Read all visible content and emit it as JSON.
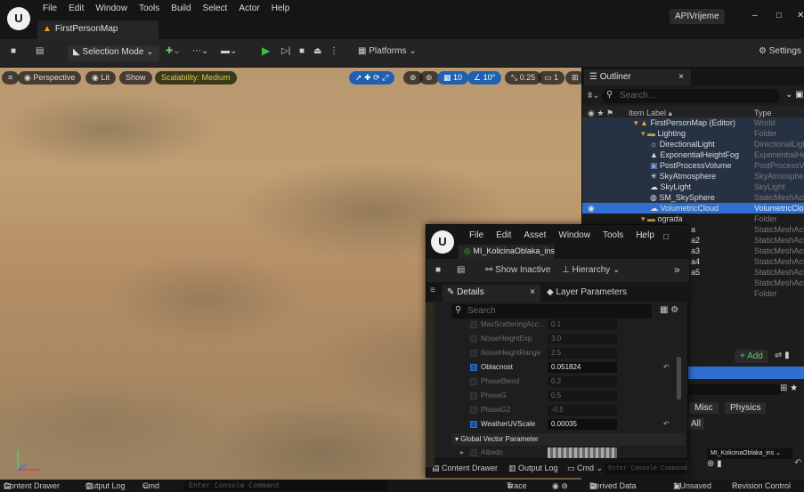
{
  "app": {
    "logo": "U",
    "menu": [
      "File",
      "Edit",
      "Window",
      "Tools",
      "Build",
      "Select",
      "Actor",
      "Help"
    ],
    "map_tab": "FirstPersonMap",
    "project": "APIVrijeme",
    "window_controls": [
      "–",
      "□",
      "✕"
    ]
  },
  "toolbar": {
    "selection_mode": "Selection Mode",
    "platforms": "Platforms",
    "settings": "Settings"
  },
  "viewport": {
    "perspective": "Perspective",
    "lit": "Lit",
    "show": "Show",
    "scalability": "Scalability: Medium",
    "grid_value": "10",
    "angle_value": "10°",
    "scale_value": "0.25",
    "camera_speed": "1"
  },
  "outliner": {
    "tab": "Outliner",
    "search_placeholder": "Search...",
    "col_label": "Item Label",
    "col_type": "Type",
    "rows": [
      {
        "label": "FirstPersonMap (Editor)",
        "type": "World"
      },
      {
        "label": "Lighting",
        "type": "Folder"
      },
      {
        "label": "DirectionalLight",
        "type": "DirectionalLight"
      },
      {
        "label": "ExponentialHeightFog",
        "type": "ExponentialHeightFog"
      },
      {
        "label": "PostProcessVolume",
        "type": "PostProcessVolume"
      },
      {
        "label": "SkyAtmosphere",
        "type": "SkyAtmosphere"
      },
      {
        "label": "SkyLight",
        "type": "SkyLight"
      },
      {
        "label": "SM_SkySphere",
        "type": "StaticMeshActor"
      },
      {
        "label": "VolumetricCloud",
        "type": "VolumetricCloud"
      },
      {
        "label": "ograda",
        "type": "Folder"
      },
      {
        "label": "a",
        "type": "StaticMeshActor"
      },
      {
        "label": "a2",
        "type": "StaticMeshActor"
      },
      {
        "label": "a3",
        "type": "StaticMeshActor"
      },
      {
        "label": "a4",
        "type": "StaticMeshActor"
      },
      {
        "label": "a5",
        "type": "StaticMeshActor"
      },
      {
        "label": "",
        "type": "StaticMeshActor"
      },
      {
        "label": "",
        "type": "Folder"
      }
    ]
  },
  "details_side": {
    "add": "+ Add",
    "misc": "Misc",
    "physics": "Physics",
    "all": "All",
    "material_value": "MI_KolicinaOblaka_ins"
  },
  "material_window": {
    "menu": [
      "File",
      "Edit",
      "Asset",
      "Window",
      "Tools",
      "Help"
    ],
    "tab": "MI_KolicinaOblaka_inst",
    "show_inactive": "Show Inactive",
    "hierarchy": "Hierarchy",
    "details_tab": "Details",
    "layer_tab": "Layer Parameters",
    "search_placeholder": "Search",
    "params": [
      {
        "name": "MaxScatteringAcc...",
        "value": "0.1",
        "on": false
      },
      {
        "name": "NoiseHeightExp",
        "value": "3.0",
        "on": false
      },
      {
        "name": "NoiseHeightRange",
        "value": "2.5",
        "on": false
      },
      {
        "name": "Oblacnost",
        "value": "0.051824",
        "on": true
      },
      {
        "name": "PhaseBlend",
        "value": "0.2",
        "on": false
      },
      {
        "name": "PhaseG",
        "value": "0.5",
        "on": false
      },
      {
        "name": "PhaseG2",
        "value": "-0.5",
        "on": false
      },
      {
        "name": "WeatherUVScale",
        "value": "0.00035",
        "on": true
      }
    ],
    "group": "Global Vector Parameter",
    "albedo": "Albedo",
    "content_drawer": "Content Drawer",
    "output_log": "Output Log",
    "cmd": "Cmd",
    "console_placeholder": "Enter Console Command"
  },
  "bottom": {
    "content_drawer": "Content Drawer",
    "output_log": "Output Log",
    "cmd": "Cmd",
    "console_placeholder": "Enter Console Command",
    "trace": "Trace",
    "derived_data": "Derived Data",
    "unsaved": "1 Unsaved",
    "revision": "Revision Control"
  }
}
